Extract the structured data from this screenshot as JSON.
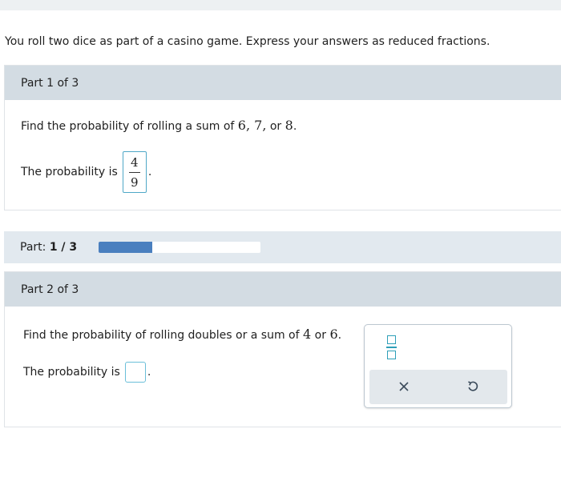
{
  "intro": "You roll two dice as part of a casino game. Express your answers as reduced fractions.",
  "part1": {
    "header": "Part 1 of 3",
    "question_prefix": "Find the probability of rolling a sum of ",
    "question_math": "6, 7,",
    "question_or": " or ",
    "question_math2": "8",
    "question_suffix": ".",
    "answer_label": "The probability is",
    "answer_numerator": "4",
    "answer_denominator": "9",
    "answer_period": "."
  },
  "progress": {
    "label_prefix": "Part: ",
    "label_value": "1 / 3",
    "fraction_complete": 0.333,
    "fill_color": "#4a7fbf"
  },
  "part2": {
    "header": "Part 2 of 3",
    "question_prefix": "Find the probability of rolling doubles or a sum of ",
    "question_math": "4",
    "question_or": " or ",
    "question_math2": "6",
    "question_suffix": ".",
    "answer_label": "The probability is",
    "answer_period": "."
  },
  "tools": {
    "fraction_icon": "fraction-template-icon",
    "clear_icon": "close-icon",
    "undo_icon": "undo-icon"
  },
  "colors": {
    "header_bg": "#d3dce3",
    "progress_bg": "#e2e9ef",
    "input_border": "#4fa8c7",
    "accent": "#2e9fb8"
  }
}
